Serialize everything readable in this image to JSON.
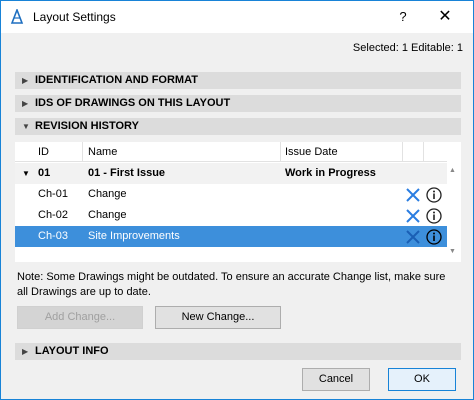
{
  "window": {
    "title": "Layout Settings",
    "help_label": "?",
    "close_label": "✕"
  },
  "header": {
    "selected_info": "Selected: 1 Editable: 1"
  },
  "sections": {
    "identification": "IDENTIFICATION AND FORMAT",
    "ids_of_drawings": "IDS OF DRAWINGS ON THIS LAYOUT",
    "revision_history": "REVISION HISTORY",
    "layout_info": "LAYOUT INFO"
  },
  "table": {
    "columns": [
      "ID",
      "Name",
      "Issue Date"
    ],
    "group": {
      "id": "01",
      "name": "01 - First Issue",
      "issue_date": "Work in Progress"
    },
    "rows": [
      {
        "id": "Ch-01",
        "name": "Change"
      },
      {
        "id": "Ch-02",
        "name": "Change"
      },
      {
        "id": "Ch-03",
        "name": "Site Improvements"
      }
    ],
    "delete_icon": "x-icon",
    "info_icon": "info-icon"
  },
  "note": "Note: Some Drawings might be outdated. To ensure an accurate Change list, make sure all Drawings are up to date.",
  "buttons": {
    "add_change": "Add Change...",
    "new_change": "New Change...",
    "cancel": "Cancel",
    "ok": "OK"
  },
  "colors": {
    "selection": "#3d8fdb",
    "accent_blue": "#1883d7",
    "section_header": "#dcdcdc"
  }
}
